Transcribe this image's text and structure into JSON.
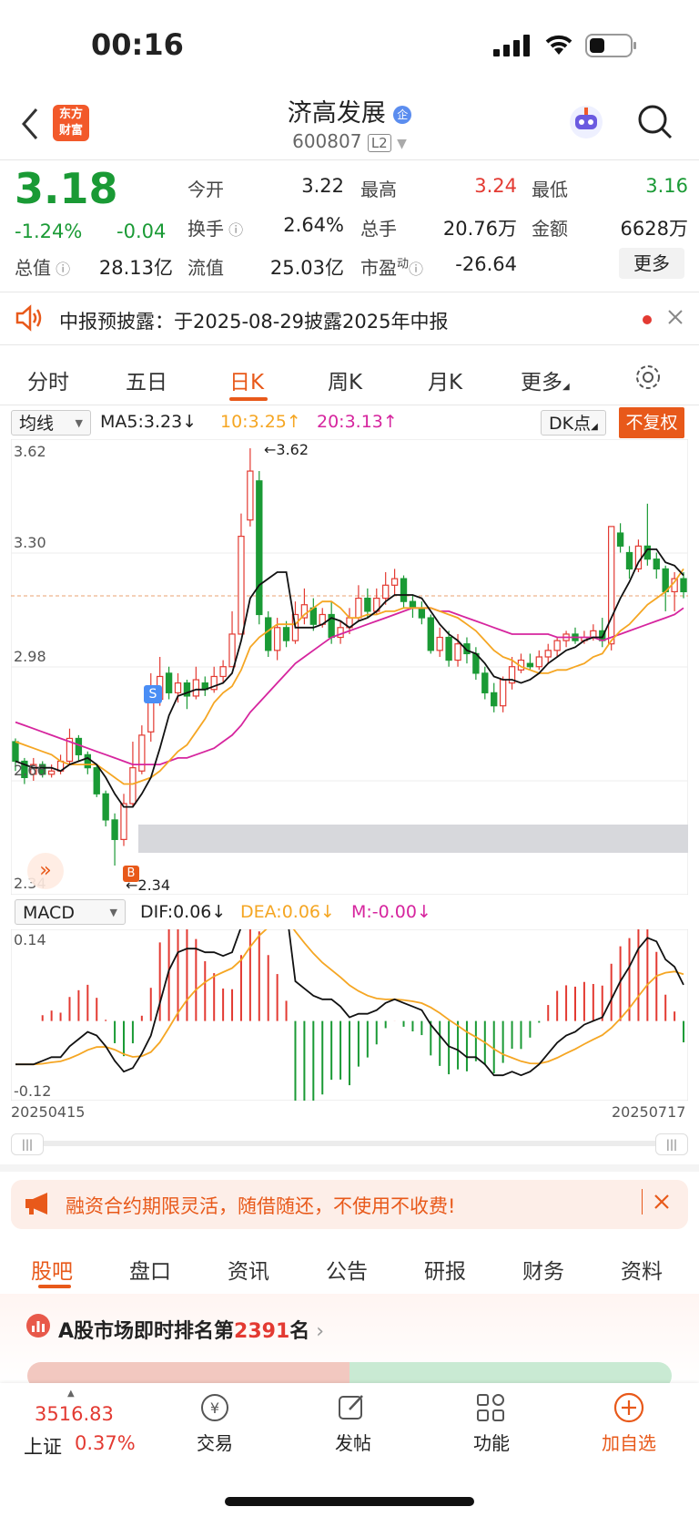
{
  "status": {
    "time": "00:16"
  },
  "header": {
    "title": "济高发展",
    "code": "600807",
    "level_badge": "L2",
    "logo_text_1": "东方",
    "logo_text_2": "财富"
  },
  "quote": {
    "price": "3.18",
    "change_pct": "-1.24%",
    "change": "-0.04",
    "open_label": "今开",
    "open": "3.22",
    "high_label": "最高",
    "high": "3.24",
    "low_label": "最低",
    "low": "3.16",
    "turnover_label": "换手",
    "turnover": "2.64%",
    "volume_label": "总手",
    "volume": "20.76万",
    "amount_label": "金额",
    "amount": "6628万",
    "total_value_label": "总值",
    "total_value": "28.13亿",
    "float_value_label": "流值",
    "float_value": "25.03亿",
    "pe_label": "市盈",
    "pe_sup": "动",
    "pe": "-26.64",
    "more_label": "更多"
  },
  "notice": {
    "text": "中报预披露：于2025-08-29披露2025年中报"
  },
  "tabs": [
    "分时",
    "五日",
    "日K",
    "周K",
    "月K",
    "更多"
  ],
  "active_tab": "日K",
  "ma": {
    "selector": "均线",
    "ma5": "MA5:3.23",
    "ma10": "10:3.25",
    "ma20": "20:3.13",
    "dk": "DK点",
    "fq": "不复权"
  },
  "chart_axis": {
    "y_labels": [
      "3.62",
      "3.30",
      "2.98",
      "2.66",
      "2.34"
    ],
    "max_label": "3.62",
    "min_label": "2.34",
    "sell_marker": "S",
    "buy_marker": "B"
  },
  "macd": {
    "selector": "MACD",
    "dif": "DIF:0.06",
    "dea": "DEA:0.06",
    "m": "M:-0.00",
    "y_top": "0.14",
    "y_bottom": "-0.12"
  },
  "dates": {
    "start": "20250415",
    "end": "20250717"
  },
  "colors": {
    "up": "#e33a32",
    "down": "#1a9a35",
    "ma10": "#f5a623",
    "ma20": "#d6259e",
    "accent": "#e8591a"
  },
  "chart_data": {
    "type": "candlestick",
    "x_range": [
      "20250415",
      "20250717"
    ],
    "ylim": [
      2.34,
      3.62
    ],
    "candles": [
      [
        2.72,
        2.66,
        2.73,
        2.63
      ],
      [
        2.66,
        2.61,
        2.67,
        2.59
      ],
      [
        2.62,
        2.65,
        2.67,
        2.6
      ],
      [
        2.65,
        2.62,
        2.66,
        2.61
      ],
      [
        2.62,
        2.63,
        2.65,
        2.61
      ],
      [
        2.63,
        2.66,
        2.68,
        2.62
      ],
      [
        2.66,
        2.73,
        2.76,
        2.65
      ],
      [
        2.73,
        2.68,
        2.74,
        2.66
      ],
      [
        2.68,
        2.64,
        2.69,
        2.62
      ],
      [
        2.64,
        2.56,
        2.65,
        2.55
      ],
      [
        2.56,
        2.48,
        2.57,
        2.46
      ],
      [
        2.48,
        2.42,
        2.5,
        2.34
      ],
      [
        2.42,
        2.53,
        2.56,
        2.4
      ],
      [
        2.53,
        2.64,
        2.72,
        2.52
      ],
      [
        2.63,
        2.74,
        2.77,
        2.62
      ],
      [
        2.75,
        2.85,
        2.93,
        2.72
      ],
      [
        2.85,
        2.92,
        2.98,
        2.83
      ],
      [
        2.93,
        2.87,
        2.95,
        2.85
      ],
      [
        2.87,
        2.9,
        2.93,
        2.84
      ],
      [
        2.9,
        2.86,
        2.91,
        2.82
      ],
      [
        2.86,
        2.91,
        2.95,
        2.85
      ],
      [
        2.9,
        2.88,
        2.92,
        2.86
      ],
      [
        2.88,
        2.92,
        2.95,
        2.87
      ],
      [
        2.92,
        2.95,
        2.97,
        2.9
      ],
      [
        2.95,
        3.05,
        3.12,
        2.95
      ],
      [
        3.05,
        3.35,
        3.42,
        3.05
      ],
      [
        3.4,
        3.55,
        3.62,
        3.38
      ],
      [
        3.52,
        3.11,
        3.55,
        3.08
      ],
      [
        3.1,
        3.0,
        3.12,
        2.98
      ],
      [
        3.0,
        3.07,
        3.1,
        2.97
      ],
      [
        3.07,
        3.03,
        3.09,
        3.01
      ],
      [
        3.03,
        3.11,
        3.15,
        3.02
      ],
      [
        3.1,
        3.14,
        3.19,
        3.08
      ],
      [
        3.13,
        3.08,
        3.16,
        3.06
      ],
      [
        3.08,
        3.11,
        3.13,
        3.07
      ],
      [
        3.11,
        3.04,
        3.15,
        3.02
      ],
      [
        3.04,
        3.07,
        3.09,
        3.02
      ],
      [
        3.07,
        3.1,
        3.13,
        3.05
      ],
      [
        3.1,
        3.16,
        3.2,
        3.09
      ],
      [
        3.16,
        3.12,
        3.19,
        3.1
      ],
      [
        3.12,
        3.16,
        3.19,
        3.11
      ],
      [
        3.16,
        3.2,
        3.24,
        3.14
      ],
      [
        3.2,
        3.22,
        3.25,
        3.17
      ],
      [
        3.22,
        3.15,
        3.23,
        3.13
      ],
      [
        3.15,
        3.13,
        3.17,
        3.1
      ],
      [
        3.13,
        3.1,
        3.15,
        3.08
      ],
      [
        3.1,
        3.0,
        3.11,
        2.99
      ],
      [
        3.0,
        3.04,
        3.07,
        2.98
      ],
      [
        3.04,
        2.97,
        3.06,
        2.95
      ],
      [
        2.97,
        3.02,
        3.05,
        2.95
      ],
      [
        3.02,
        2.99,
        3.04,
        2.96
      ],
      [
        2.99,
        2.93,
        3.01,
        2.91
      ],
      [
        2.93,
        2.87,
        2.95,
        2.85
      ],
      [
        2.87,
        2.83,
        2.9,
        2.81
      ],
      [
        2.83,
        2.91,
        2.92,
        2.81
      ],
      [
        2.9,
        2.95,
        2.98,
        2.88
      ],
      [
        2.94,
        2.97,
        2.99,
        2.93
      ],
      [
        2.96,
        2.95,
        2.99,
        2.94
      ],
      [
        2.95,
        2.98,
        3.0,
        2.94
      ],
      [
        2.98,
        3.0,
        3.02,
        2.96
      ],
      [
        3.0,
        3.03,
        3.04,
        2.98
      ],
      [
        3.03,
        3.05,
        3.06,
        3.01
      ],
      [
        3.05,
        3.03,
        3.07,
        3.02
      ],
      [
        3.03,
        3.04,
        3.06,
        3.02
      ],
      [
        3.04,
        3.06,
        3.08,
        3.03
      ],
      [
        3.06,
        3.03,
        3.1,
        3.01
      ],
      [
        3.02,
        3.38,
        3.38,
        3.0
      ],
      [
        3.36,
        3.32,
        3.39,
        3.3
      ],
      [
        3.3,
        3.25,
        3.32,
        3.22
      ],
      [
        3.25,
        3.32,
        3.34,
        3.24
      ],
      [
        3.32,
        3.28,
        3.45,
        3.26
      ],
      [
        3.28,
        3.25,
        3.3,
        3.22
      ],
      [
        3.25,
        3.18,
        3.26,
        3.12
      ],
      [
        3.18,
        3.22,
        3.24,
        3.12
      ],
      [
        3.22,
        3.18,
        3.24,
        3.16
      ]
    ],
    "ma5": [
      2.66,
      2.65,
      2.64,
      2.64,
      2.64,
      2.63,
      2.65,
      2.66,
      2.67,
      2.65,
      2.61,
      2.56,
      2.52,
      2.52,
      2.56,
      2.61,
      2.7,
      2.8,
      2.86,
      2.87,
      2.88,
      2.88,
      2.89,
      2.9,
      2.93,
      3.03,
      3.16,
      3.2,
      3.22,
      3.24,
      3.24,
      3.07,
      3.07,
      3.07,
      3.08,
      3.1,
      3.09,
      3.07,
      3.09,
      3.1,
      3.12,
      3.15,
      3.17,
      3.17,
      3.17,
      3.16,
      3.12,
      3.08,
      3.05,
      3.03,
      3.0,
      2.99,
      2.96,
      2.92,
      2.91,
      2.91,
      2.9,
      2.91,
      2.93,
      2.96,
      2.98,
      3.0,
      3.01,
      3.03,
      3.04,
      3.04,
      3.1,
      3.16,
      3.21,
      3.27,
      3.31,
      3.31,
      3.27,
      3.26,
      3.23
    ],
    "ma10": [
      2.72,
      2.71,
      2.7,
      2.69,
      2.68,
      2.66,
      2.65,
      2.65,
      2.65,
      2.65,
      2.63,
      2.61,
      2.59,
      2.59,
      2.6,
      2.61,
      2.63,
      2.66,
      2.69,
      2.71,
      2.75,
      2.79,
      2.84,
      2.87,
      2.89,
      2.94,
      3.01,
      3.04,
      3.06,
      3.08,
      3.08,
      3.08,
      3.11,
      3.13,
      3.15,
      3.15,
      3.13,
      3.1,
      3.1,
      3.11,
      3.11,
      3.12,
      3.12,
      3.13,
      3.13,
      3.13,
      3.13,
      3.12,
      3.11,
      3.1,
      3.08,
      3.06,
      3.03,
      3.0,
      2.98,
      2.97,
      2.95,
      2.94,
      2.93,
      2.93,
      2.94,
      2.94,
      2.95,
      2.96,
      2.98,
      2.99,
      3.03,
      3.06,
      3.08,
      3.11,
      3.14,
      3.16,
      3.18,
      3.21,
      3.25
    ],
    "ma20": [
      2.78,
      2.77,
      2.76,
      2.75,
      2.74,
      2.73,
      2.72,
      2.71,
      2.7,
      2.69,
      2.68,
      2.67,
      2.66,
      2.65,
      2.65,
      2.65,
      2.65,
      2.66,
      2.67,
      2.67,
      2.68,
      2.69,
      2.7,
      2.72,
      2.74,
      2.77,
      2.81,
      2.84,
      2.87,
      2.9,
      2.93,
      2.96,
      2.98,
      3.0,
      3.02,
      3.04,
      3.05,
      3.06,
      3.07,
      3.08,
      3.09,
      3.1,
      3.11,
      3.12,
      3.13,
      3.13,
      3.13,
      3.12,
      3.12,
      3.11,
      3.1,
      3.09,
      3.08,
      3.07,
      3.06,
      3.05,
      3.05,
      3.05,
      3.05,
      3.05,
      3.04,
      3.04,
      3.04,
      3.04,
      3.04,
      3.03,
      3.04,
      3.05,
      3.06,
      3.07,
      3.08,
      3.09,
      3.1,
      3.11,
      3.13
    ]
  },
  "promo": {
    "text": "融资合约期限灵活，随借随还，不使用不收费!"
  },
  "bottom_tabs": [
    "股吧",
    "盘口",
    "资讯",
    "公告",
    "研报",
    "财务",
    "资料"
  ],
  "rank": {
    "prefix": "A股市场即时排名第",
    "number": "2391",
    "suffix": "名"
  },
  "bottom_nav": {
    "index_value": "3516.83",
    "index_name": "上证",
    "index_pct": "0.37%",
    "trade": "交易",
    "post": "发帖",
    "func": "功能",
    "add": "加自选"
  }
}
